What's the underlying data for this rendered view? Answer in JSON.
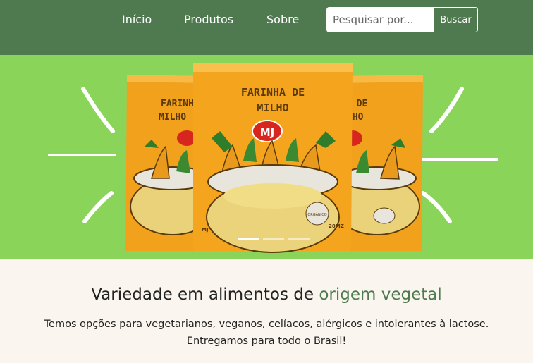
{
  "nav": {
    "links": [
      "Início",
      "Produtos",
      "Sobre"
    ],
    "search_placeholder": "Pesquisar por...",
    "search_button": "Buscar"
  },
  "banner": {
    "product_title_line1": "FARINHA DE",
    "product_title_line2": "MILHO",
    "brand": "MJ",
    "badge": "ORGÂNICO",
    "weight": "20MZ",
    "slide_indicators": 3,
    "active_slide": 1
  },
  "content": {
    "headline_main": "Variedade em alimentos de ",
    "headline_accent": "origem vegetal",
    "desc_line1": "Temos opções para vegetarianos, veganos, celíacos, alérgicos e intolerantes à lactose.",
    "desc_line2": "Entregamos para todo o Brasil!"
  },
  "colors": {
    "nav_bg": "#4f7a4f",
    "banner_bg": "#8ad45a",
    "package": "#f5a41e",
    "accent_text": "#4f7a4f",
    "page_bg": "#faf6ef"
  }
}
